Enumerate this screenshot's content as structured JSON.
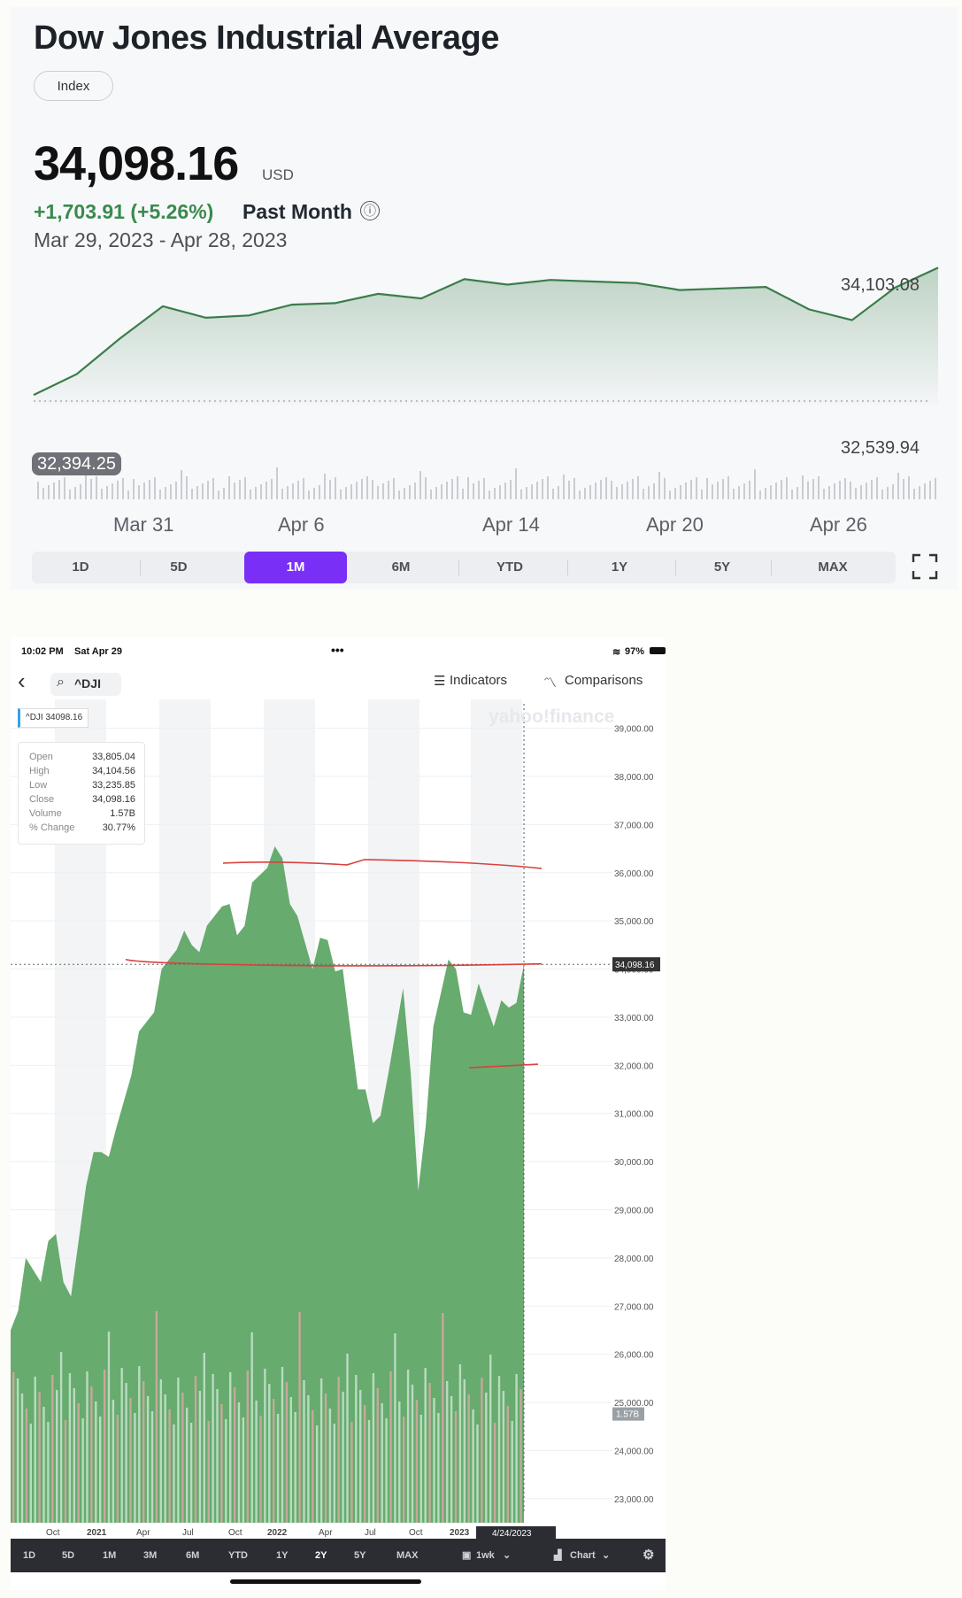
{
  "top": {
    "title": "Dow Jones Industrial Average",
    "index_pill": "Index",
    "price": "34,098.16",
    "currency": "USD",
    "change": "+1,703.91 (+5.26%)",
    "period": "Past Month",
    "info_icon": "ⓘ",
    "date_range": "Mar 29, 2023 - Apr 28, 2023",
    "high_label": "34,103.08",
    "low_label": "32,539.94",
    "prev_close_badge": "32,394.25",
    "ranges": [
      "1D",
      "5D",
      "1M",
      "6M",
      "YTD",
      "1Y",
      "5Y",
      "MAX"
    ],
    "active_range": "1M",
    "accent": "#7a2ff7",
    "line_color": "#3a7d4a"
  },
  "chart_data": [
    {
      "type": "area",
      "title": "Dow Jones Industrial Average",
      "x_ticks": [
        "Mar 31",
        "Apr 6",
        "Apr 14",
        "Apr 20",
        "Apr 26"
      ],
      "x": [
        "Mar 29",
        "Mar 30",
        "Mar 31",
        "Apr 3",
        "Apr 4",
        "Apr 5",
        "Apr 6",
        "Apr 10",
        "Apr 11",
        "Apr 12",
        "Apr 13",
        "Apr 14",
        "Apr 17",
        "Apr 18",
        "Apr 19",
        "Apr 20",
        "Apr 21",
        "Apr 24",
        "Apr 25",
        "Apr 26",
        "Apr 27",
        "Apr 28"
      ],
      "values": [
        32450,
        32720,
        33180,
        33600,
        33450,
        33480,
        33620,
        33640,
        33760,
        33700,
        33950,
        33880,
        33940,
        33920,
        33900,
        33810,
        33830,
        33850,
        33560,
        33420,
        33840,
        34098
      ],
      "ylim": [
        32394.25,
        34103.08
      ],
      "reference_line": 32394.25,
      "high": 34103.08,
      "low": 32539.94,
      "volume_bars": true
    },
    {
      "type": "area",
      "series_label": "^DJI 34098.16",
      "x_ticks": [
        "Oct",
        "2021",
        "Apr",
        "Jul",
        "Oct",
        "2022",
        "Apr",
        "Jul",
        "Oct",
        "2023"
      ],
      "x": [
        "2020-06",
        "2020-07",
        "2020-08",
        "2020-09",
        "2020-10",
        "2020-11",
        "2020-12",
        "2021-01",
        "2021-02",
        "2021-03",
        "2021-04",
        "2021-05",
        "2021-06",
        "2021-07",
        "2021-08",
        "2021-09",
        "2021-10",
        "2021-11",
        "2021-12",
        "2022-01",
        "2022-02",
        "2022-03",
        "2022-04",
        "2022-05",
        "2022-06",
        "2022-07",
        "2022-08",
        "2022-09",
        "2022-10",
        "2022-11",
        "2022-12",
        "2023-01",
        "2023-02",
        "2023-03",
        "2023-04"
      ],
      "values": [
        26500,
        28000,
        27500,
        28500,
        27200,
        29500,
        30200,
        30700,
        31800,
        32900,
        34000,
        34400,
        34500,
        34900,
        35300,
        34700,
        35800,
        36100,
        36300,
        35100,
        34000,
        34600,
        34000,
        31500,
        30800,
        31800,
        33600,
        29400,
        32800,
        34200,
        33100,
        33700,
        32800,
        33200,
        34098
      ],
      "ylim": [
        22500,
        39600
      ],
      "y_ticks": [
        "39,000.00",
        "38,000.00",
        "37,000.00",
        "36,000.00",
        "35,000.00",
        "34,000.00",
        "33,000.00",
        "32,000.00",
        "31,000.00",
        "30,000.00",
        "29,000.00",
        "28,000.00",
        "27,000.00",
        "26,000.00",
        "25,000.00",
        "24,000.00",
        "23,000.00"
      ],
      "last_value": "34,098.16",
      "volume_value": "1.57B",
      "crosshair_date": "4/24/2023",
      "annotation_lines": [
        36200,
        34090,
        31950
      ]
    }
  ],
  "mobile": {
    "time": "10:02 PM",
    "date": "Sat Apr 29",
    "dots": "•••",
    "battery": "97%",
    "back_icon": "‹",
    "search_icon": "⌕",
    "symbol": "^DJI",
    "indicators": "Indicators",
    "comparisons": "Comparisons",
    "watermark": "yahoo!finance",
    "tag": "^DJI 34098.16",
    "ohlc": [
      {
        "k": "Open",
        "v": "33,805.04"
      },
      {
        "k": "High",
        "v": "34,104.56"
      },
      {
        "k": "Low",
        "v": "33,235.85"
      },
      {
        "k": "Close",
        "v": "34,098.16"
      },
      {
        "k": "Volume",
        "v": "1.57B"
      },
      {
        "k": "% Change",
        "v": "30.77%"
      }
    ],
    "ranges": [
      "1D",
      "5D",
      "1M",
      "3M",
      "6M",
      "YTD",
      "1Y",
      "2Y",
      "5Y",
      "MAX"
    ],
    "active_range": "2Y",
    "interval": "1wk",
    "chart_type": "Chart",
    "area_color": "#67ab6e",
    "annotation_color": "#d9413f"
  }
}
